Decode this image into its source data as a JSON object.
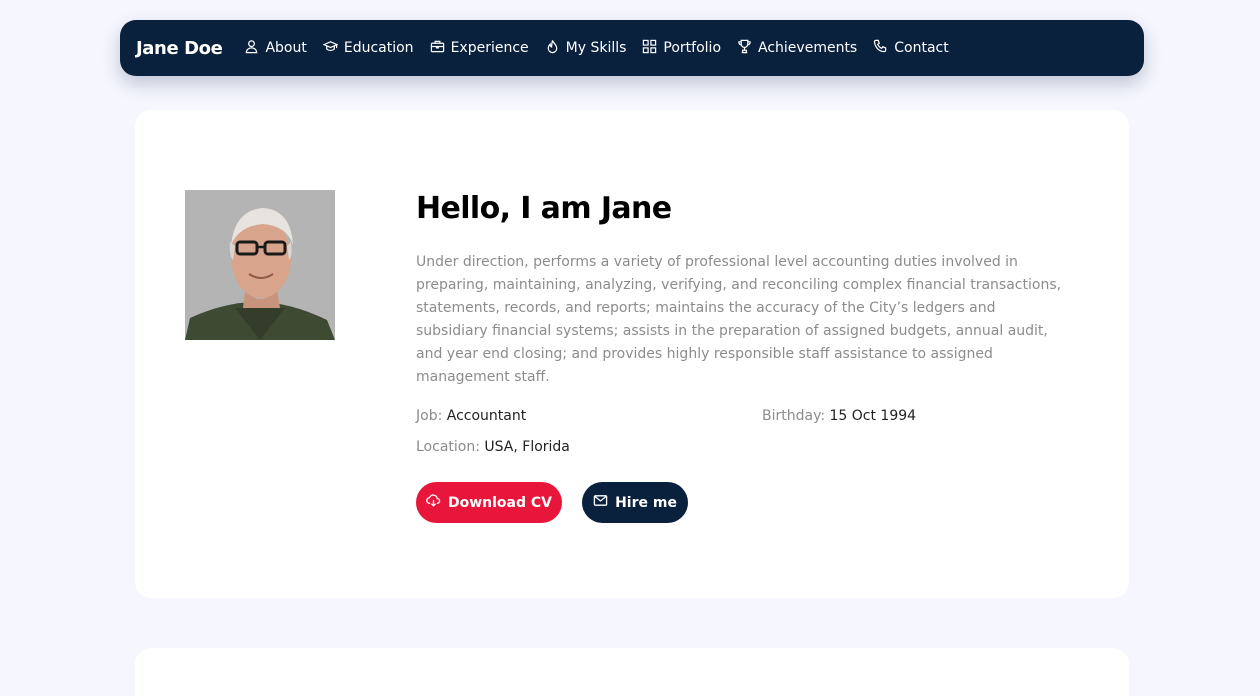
{
  "nav": {
    "brand": "Jane Doe",
    "items": [
      {
        "label": "About",
        "icon": "user-icon"
      },
      {
        "label": "Education",
        "icon": "graduation-cap-icon"
      },
      {
        "label": "Experience",
        "icon": "briefcase-icon"
      },
      {
        "label": "My Skills",
        "icon": "fire-icon"
      },
      {
        "label": "Portfolio",
        "icon": "grid-icon"
      },
      {
        "label": "Achievements",
        "icon": "trophy-icon"
      },
      {
        "label": "Contact",
        "icon": "phone-icon"
      }
    ]
  },
  "hero": {
    "title": "Hello, I am Jane",
    "description": "Under direction, performs a variety of professional level accounting duties involved in preparing, maintaining, analyzing, verifying, and reconciling complex financial transactions, statements, records, and reports; maintains the accuracy of the City’s ledgers and subsidiary financial systems; assists in the preparation of assigned budgets, annual audit, and year end closing; and provides highly responsible staff assistance to assigned management staff.",
    "info": {
      "job_label": "Job:",
      "job_value": "Accountant",
      "birthday_label": "Birthday:",
      "birthday_value": "15 Oct 1994",
      "location_label": "Location:",
      "location_value": "USA, Florida"
    },
    "buttons": {
      "download_label": "Download CV",
      "download_icon": "cloud-download-icon",
      "hire_label": "Hire me",
      "hire_icon": "envelope-icon"
    }
  },
  "colors": {
    "page_background": "#f5f6fe",
    "navy": "#0a213e",
    "accent_red": "#e7163a",
    "muted_text": "#8c8c8c"
  }
}
